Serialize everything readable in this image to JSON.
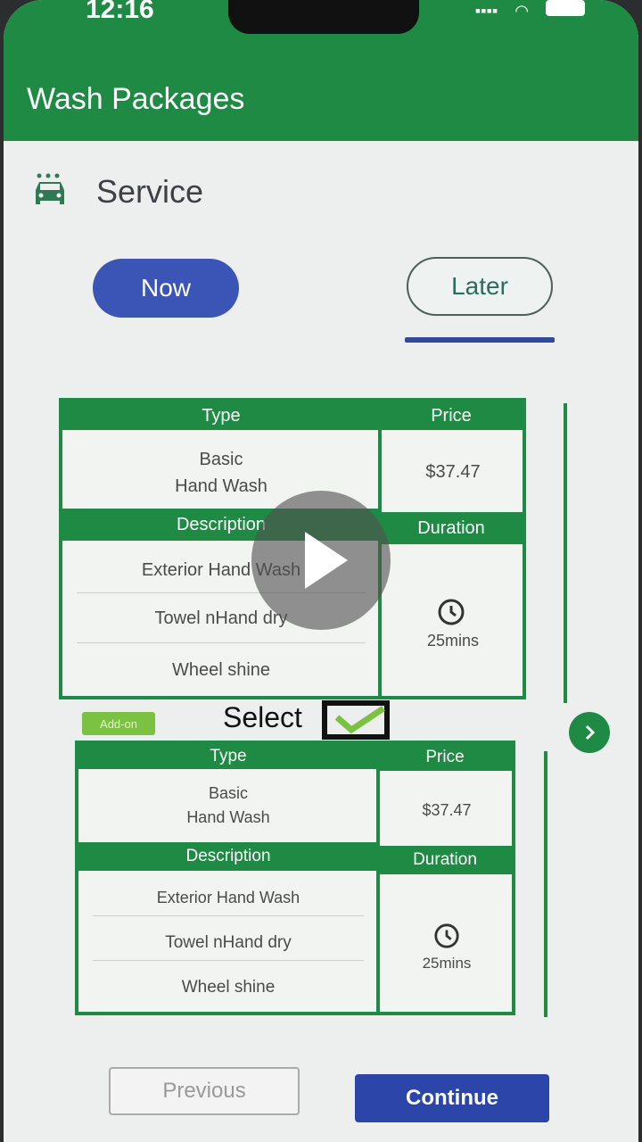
{
  "status_bar": {
    "time": "12:16"
  },
  "header": {
    "title": "Wash Packages"
  },
  "service": {
    "label": "Service",
    "icon": "car-icon"
  },
  "tabs": [
    {
      "label": "Now",
      "selected": true
    },
    {
      "label": "Later",
      "selected": false
    }
  ],
  "packages": [
    {
      "type_header": "Type",
      "price_header": "Price",
      "type_line1": "Basic",
      "type_line2": "Hand Wash",
      "price": "$37.47",
      "description_header": "Description",
      "duration_header": "Duration",
      "items": [
        "Exterior Hand Wash",
        "Towel nHand dry",
        "Wheel shine"
      ],
      "duration": "25mins"
    },
    {
      "type_header": "Type",
      "price_header": "Price",
      "type_line1": "Basic",
      "type_line2": "Hand Wash",
      "price": "$37.47",
      "description_header": "Description",
      "duration_header": "Duration",
      "items": [
        "Exterior Hand Wash",
        "Towel nHand dry",
        "Wheel shine"
      ],
      "duration": "25mins"
    }
  ],
  "addon_badge": "Add-on",
  "select_label": "Select",
  "buttons": {
    "previous": "Previous",
    "continue": "Continue"
  },
  "colors": {
    "primary": "#1e8a43",
    "accent": "#3b55b7",
    "addon": "#7cc242"
  }
}
